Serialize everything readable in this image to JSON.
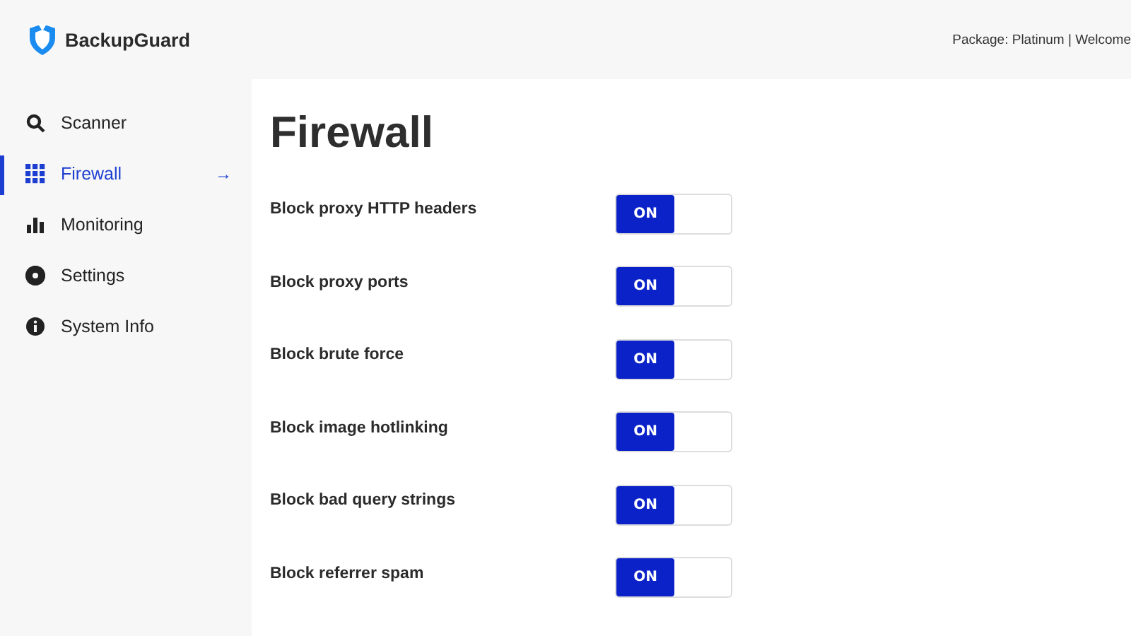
{
  "brand": "BackupGuard",
  "header": {
    "account_text": "Package: Platinum | Welcome"
  },
  "sidebar": {
    "items": [
      {
        "label": "Scanner",
        "selected": false
      },
      {
        "label": "Firewall",
        "selected": true,
        "arrow": "→"
      },
      {
        "label": "Monitoring",
        "selected": false
      },
      {
        "label": "Settings",
        "selected": false
      },
      {
        "label": "System Info",
        "selected": false
      }
    ]
  },
  "page_title": "Firewall",
  "settings": [
    {
      "label": "Block proxy HTTP headers",
      "on": true,
      "toggle_text": "ON"
    },
    {
      "label": "Block proxy ports",
      "on": true,
      "toggle_text": "ON"
    },
    {
      "label": "Block brute force",
      "on": true,
      "toggle_text": "ON"
    },
    {
      "label": "Block image hotlinking",
      "on": true,
      "toggle_text": "ON"
    },
    {
      "label": "Block bad query strings",
      "on": true,
      "toggle_text": "ON"
    },
    {
      "label": "Block referrer spam",
      "on": true,
      "toggle_text": "ON"
    }
  ]
}
